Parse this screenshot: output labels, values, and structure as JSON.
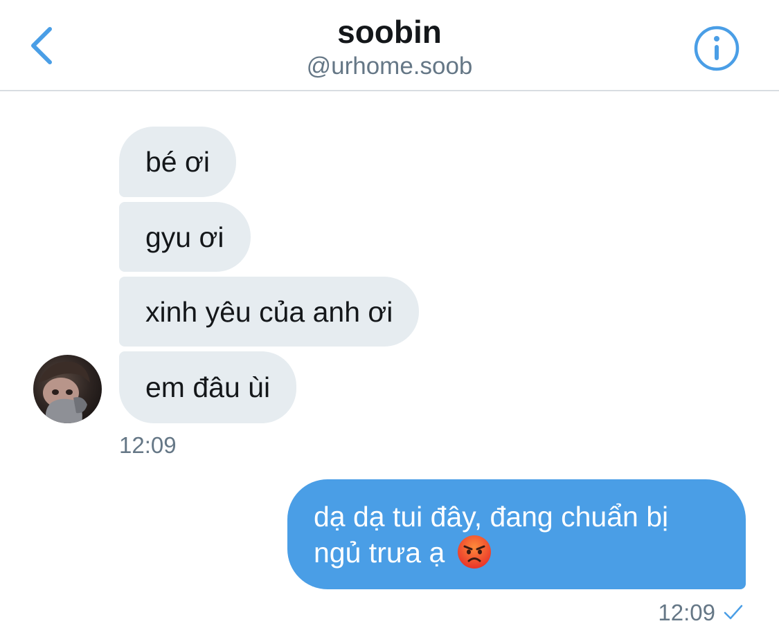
{
  "header": {
    "name": "soobin",
    "handle": "@urhome.soob"
  },
  "icons": {
    "back": "chevron-left-icon",
    "info": "info-icon",
    "read_receipt": "checkmark-icon",
    "emoji": "angry-face-emoji"
  },
  "colors": {
    "accent": "#4a9ee6",
    "incoming_bubble": "#e6ecf0",
    "text": "#14171a",
    "muted": "#657786"
  },
  "messages": {
    "incoming": [
      {
        "text": "bé ơi"
      },
      {
        "text": "gyu ơi"
      },
      {
        "text": "xinh yêu của anh ơi"
      },
      {
        "text": "em đâu ùi"
      }
    ],
    "incoming_time": "12:09",
    "outgoing": {
      "line1": "dạ dạ tui đây, đang chuẩn bị",
      "line2": "ngủ trưa ạ"
    },
    "outgoing_time": "12:09"
  }
}
